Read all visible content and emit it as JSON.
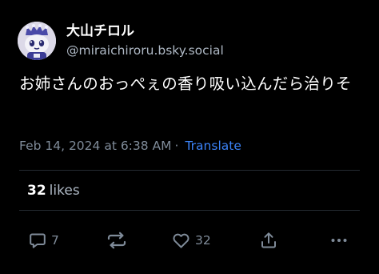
{
  "author": {
    "display_name": "大山チロル",
    "handle": "@miraichiroru.bsky.social",
    "avatar": "avatar-character-icon"
  },
  "post": {
    "text": "お姉さんのおっぺぇの香り吸い込んだら治りそ",
    "timestamp": "Feb 14, 2024 at 6:38 AM",
    "separator": "·",
    "translate_label": "Translate"
  },
  "stats": {
    "likes_count": "32",
    "likes_label": "likes"
  },
  "actions": {
    "reply": {
      "icon": "reply-icon",
      "count": "7"
    },
    "repost": {
      "icon": "repost-icon",
      "count": ""
    },
    "like": {
      "icon": "heart-icon",
      "count": "32"
    },
    "share": {
      "icon": "share-icon"
    },
    "more": {
      "icon": "more-icon"
    }
  },
  "colors": {
    "background": "#000000",
    "text_primary": "#ffffff",
    "text_secondary": "#7f8b99",
    "link": "#3b82f6",
    "divider": "#242a31"
  }
}
